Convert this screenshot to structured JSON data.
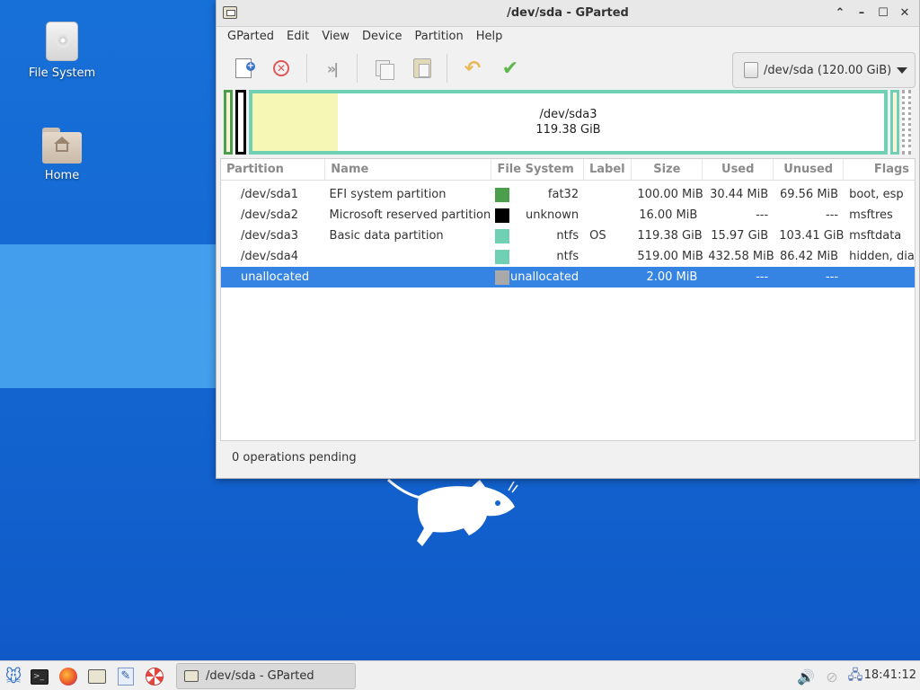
{
  "desktop": {
    "icons": [
      {
        "label": "File System",
        "icon": "drive-icon"
      },
      {
        "label": "Home",
        "icon": "home-folder-icon"
      }
    ]
  },
  "window": {
    "title": "/dev/sda - GParted",
    "menu": [
      "GParted",
      "Edit",
      "View",
      "Device",
      "Partition",
      "Help"
    ],
    "device_selector": "/dev/sda (120.00 GiB)",
    "diskmap": {
      "selected_label": "/dev/sda3",
      "selected_size": "119.38 GiB",
      "colors": {
        "fat32": "#4b9e4b",
        "unknown": "#000000",
        "ntfs": "#6fd0b4",
        "used_fill": "#f7f7b5",
        "unallocated": "#a9a9a9"
      }
    },
    "table": {
      "columns": [
        "Partition",
        "Name",
        "File System",
        "Label",
        "Size",
        "Used",
        "Unused",
        "Flags"
      ],
      "rows": [
        {
          "partition": "/dev/sda1",
          "name": "EFI system partition",
          "fs": "fat32",
          "fs_color": "#4b9e4b",
          "label": "",
          "size": "100.00 MiB",
          "used": "30.44 MiB",
          "unused": "69.56 MiB",
          "flags": "boot, esp",
          "warning": false
        },
        {
          "partition": "/dev/sda2",
          "name": "Microsoft reserved partition",
          "fs": "unknown",
          "fs_color": "#000000",
          "label": "",
          "size": "16.00 MiB",
          "used": "---",
          "unused": "---",
          "flags": "msftres",
          "warning": true
        },
        {
          "partition": "/dev/sda3",
          "name": "Basic data partition",
          "fs": "ntfs",
          "fs_color": "#6fd0b4",
          "label": "OS",
          "size": "119.38 GiB",
          "used": "15.97 GiB",
          "unused": "103.41 GiB",
          "flags": "msftdata",
          "warning": false
        },
        {
          "partition": "/dev/sda4",
          "name": "",
          "fs": "ntfs",
          "fs_color": "#6fd0b4",
          "label": "",
          "size": "519.00 MiB",
          "used": "432.58 MiB",
          "unused": "86.42 MiB",
          "flags": "hidden, diag",
          "warning": false
        },
        {
          "partition": "unallocated",
          "name": "",
          "fs": "unallocated",
          "fs_color": "#a9a9a9",
          "label": "",
          "size": "2.00 MiB",
          "used": "---",
          "unused": "---",
          "flags": "",
          "warning": false,
          "selected": true
        }
      ]
    },
    "status": "0 operations pending"
  },
  "taskbar": {
    "task_title": "/dev/sda - GParted",
    "clock": "18:41:12"
  }
}
